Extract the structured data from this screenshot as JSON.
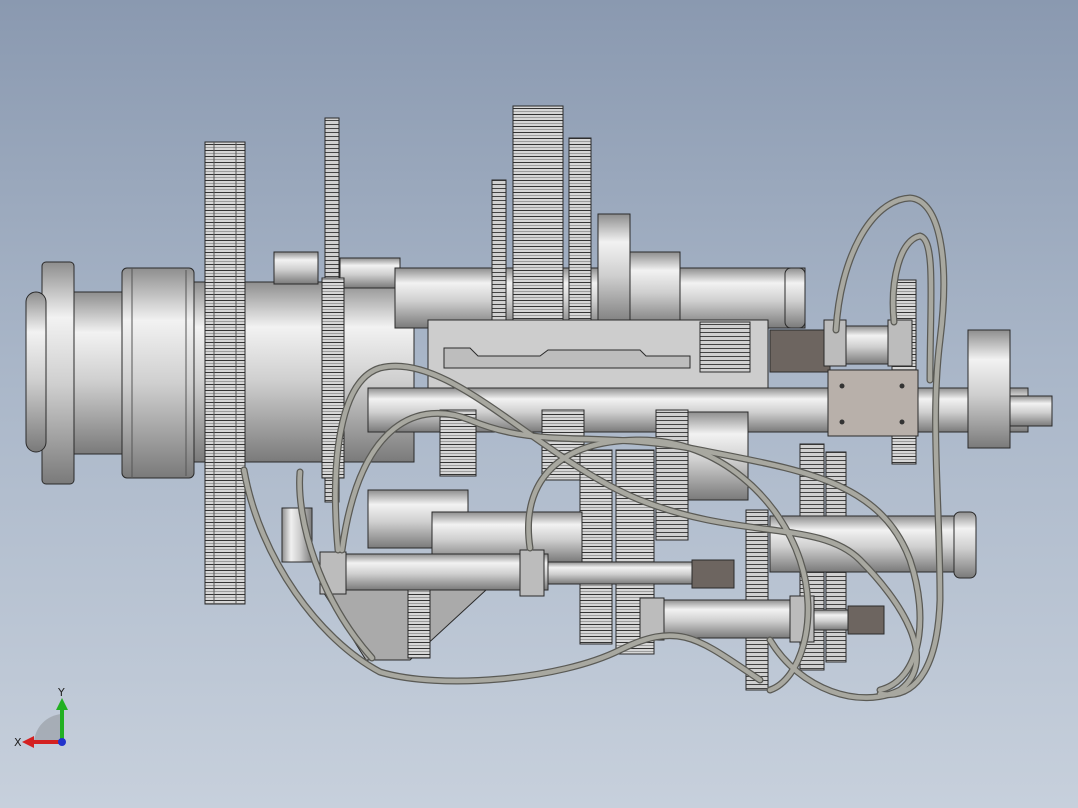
{
  "viewport": {
    "background_top": "#8a99b0",
    "background_bottom": "#c7d0dc"
  },
  "model": {
    "shaded_color": "#c8c8c8",
    "edge_color": "#2a2a2a",
    "hose_color": "#9c9c94",
    "dark_part_color": "#6d6560"
  },
  "triad": {
    "x_label": "X",
    "y_label": "Y",
    "x_color": "#d42020",
    "y_color": "#22b022",
    "z_color": "#2233cc"
  }
}
